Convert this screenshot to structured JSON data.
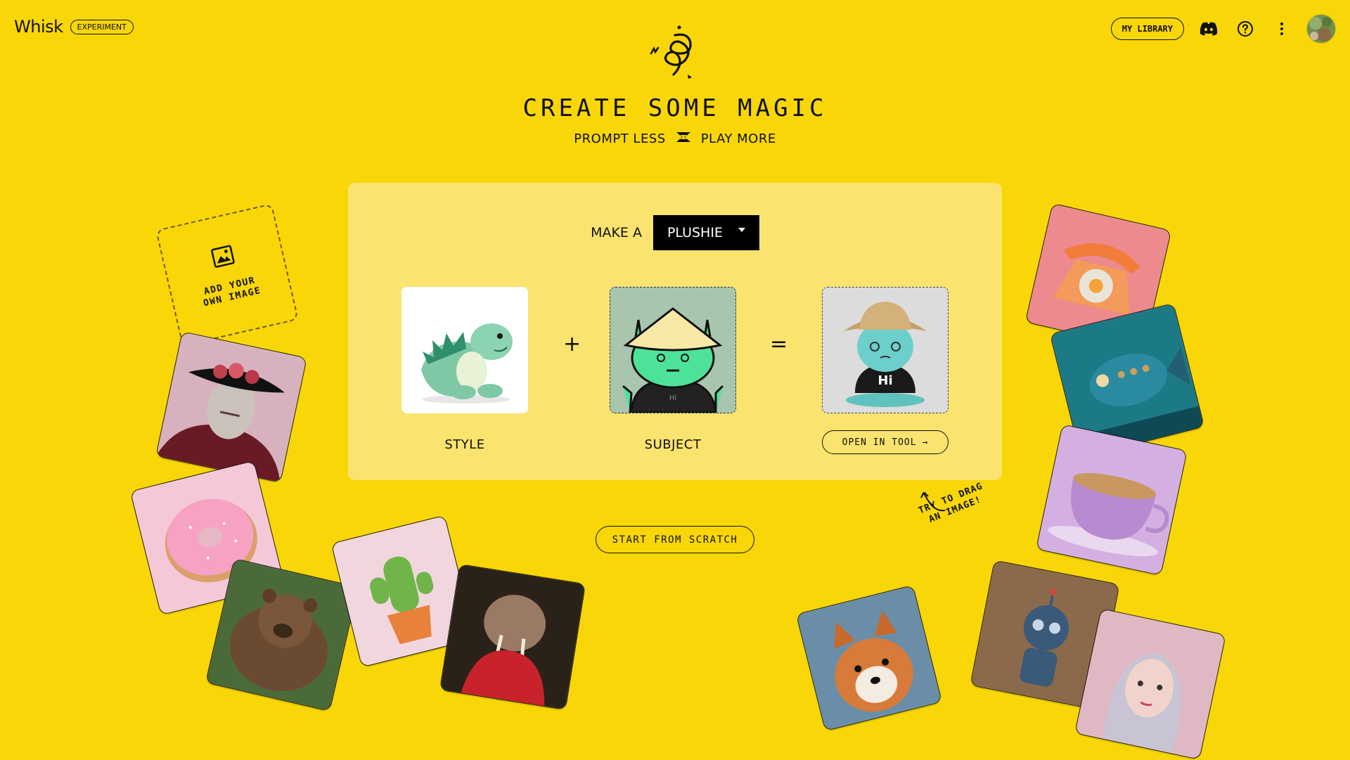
{
  "header": {
    "brand": "Whisk",
    "badge": "EXPERIMENT",
    "library_label": "MY LIBRARY",
    "icons": [
      "discord-icon",
      "help-icon",
      "more-vert-icon"
    ]
  },
  "hero": {
    "title": "CREATE SOME MAGIC",
    "subtitle_left": "PROMPT LESS",
    "subtitle_right": "PLAY MORE"
  },
  "card": {
    "make_prefix": "MAKE A",
    "make_value": "PLUSHIE",
    "style_label": "STYLE",
    "subject_label": "SUBJECT",
    "plus": "+",
    "equals": "=",
    "open_label": "OPEN IN TOOL",
    "subject_shirt_text": "Hi",
    "result_shirt_text": "Hi"
  },
  "add_image": {
    "line1": "ADD YOUR",
    "line2": "OWN IMAGE"
  },
  "start_label": "START FROM SCRATCH",
  "hint": {
    "line1": "TRY TO DRAG",
    "line2": "AN IMAGE!"
  },
  "colors": {
    "background": "#f9d608",
    "card": "#fbe36f",
    "select_bg": "#000000"
  },
  "floating_images": [
    "vampire-portrait",
    "pink-donut",
    "brown-bear",
    "potted-cactus",
    "walrus",
    "orange-rotary-phone",
    "mechanical-fish",
    "urchin-teacup",
    "shiba-dog",
    "small-robot",
    "silver-hair-woman"
  ]
}
